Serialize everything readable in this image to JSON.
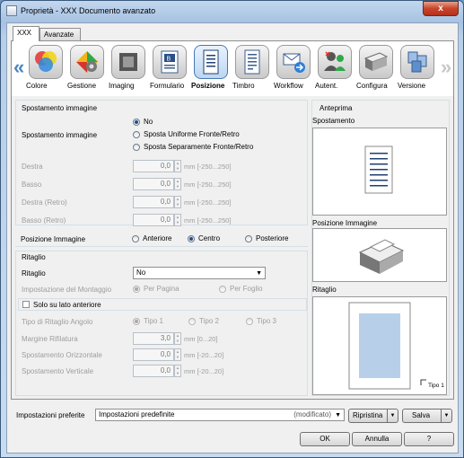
{
  "window": {
    "title": "Proprietà - XXX Documento avanzato",
    "close_label": "x"
  },
  "tabs": [
    {
      "label": "XXX"
    },
    {
      "label": "Avanzate"
    }
  ],
  "ribbon": {
    "left_arrow": "«",
    "right_arrow": "»",
    "items": [
      {
        "label": "Colore",
        "icon": "color-icon"
      },
      {
        "label": "Gestione",
        "icon": "management-icon"
      },
      {
        "label": "Imaging",
        "icon": "imaging-icon"
      },
      {
        "label": "Formulario",
        "icon": "form-icon"
      },
      {
        "label": "Posizione",
        "icon": "position-icon",
        "selected": true
      },
      {
        "label": "Timbro",
        "icon": "stamp-icon"
      },
      {
        "label": "Workflow",
        "icon": "workflow-icon"
      },
      {
        "label": "Autent.",
        "icon": "authentication-icon"
      },
      {
        "label": "Configura",
        "icon": "configure-icon"
      },
      {
        "label": "Versione",
        "icon": "version-icon"
      }
    ]
  },
  "image_shift": {
    "section_title": "Spostamento immagine",
    "label": "Spostamento immagine",
    "options": [
      "No",
      "Sposta Uniforme Fronte/Retro",
      "Sposta Separamente Fronte/Retro"
    ],
    "selected": "No",
    "fields": [
      {
        "label": "Destra",
        "value": "0,0",
        "unit": "mm [-250...250]"
      },
      {
        "label": "Basso",
        "value": "0,0",
        "unit": "mm [-250...250]"
      },
      {
        "label": "Destra (Retro)",
        "value": "0,0",
        "unit": "mm [-250...250]"
      },
      {
        "label": "Basso (Retro)",
        "value": "0,0",
        "unit": "mm [-250...250]"
      }
    ]
  },
  "image_position": {
    "label": "Posizione Immagine",
    "options": [
      "Anteriore",
      "Centro",
      "Posteriore"
    ],
    "selected": "Centro"
  },
  "trimming": {
    "section_title": "Ritaglio",
    "label": "Ritaglio",
    "value": "No",
    "layout_label": "Impostazione del Montaggio",
    "layout_options": [
      "Per Pagina",
      "Per Foglio"
    ],
    "layout_selected": "Per Pagina",
    "front_only": "Solo su lato anteriore",
    "corner_label": "Tipo di Ritaglio Angolo",
    "corner_options": [
      "Tipo 1",
      "Tipo 2",
      "Tipo 3"
    ],
    "corner_selected": "Tipo 1",
    "fields": [
      {
        "label": "Margine Rifilatura",
        "value": "3,0",
        "unit": "mm [0...20]"
      },
      {
        "label": "Spostamento Orizzontale",
        "value": "0,0",
        "unit": "mm [-20...20]"
      },
      {
        "label": "Spostamento Verticale",
        "value": "0,0",
        "unit": "mm [-20...20]"
      }
    ]
  },
  "preview": {
    "title": "Anteprima",
    "shift_label": "Spostamento",
    "position_label": "Posizione Immagine",
    "trim_label": "Ritaglio",
    "trim_type": "Tipo 1"
  },
  "favorites": {
    "label": "Impostazioni preferite",
    "value": "Impostazioni predefinite",
    "modified": "(modificato)",
    "restore": "Ripristina",
    "save": "Salva"
  },
  "buttons": {
    "ok": "OK",
    "cancel": "Annulla",
    "help": "?"
  },
  "colors": {
    "accent": "#4d86c2",
    "selected_tool": "#bcd6f1",
    "trim_preview": "#b8cfea"
  }
}
